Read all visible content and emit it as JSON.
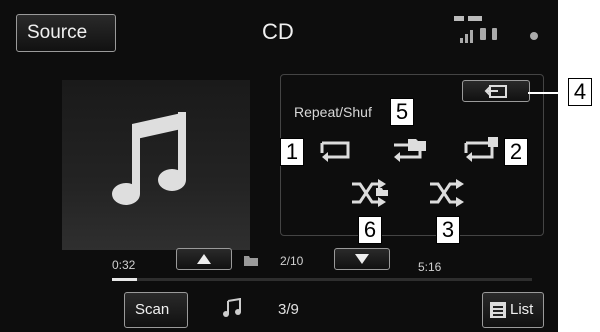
{
  "header": {
    "source_label": "Source",
    "title": "CD"
  },
  "repeat_shuffle": {
    "label": "Repeat/Shuf"
  },
  "playback": {
    "elapsed": "0:32",
    "track_position": "2/10",
    "total": "5:16",
    "progress_fraction": 0.06
  },
  "footer": {
    "scan_label": "Scan",
    "track_count": "3/9",
    "list_label": "List"
  },
  "callouts": {
    "c1": "1",
    "c2": "2",
    "c3": "3",
    "c4": "4",
    "c5": "5",
    "c6": "6"
  },
  "colors": {
    "screen_bg": "#0d0d0d",
    "text": "#e0e0e0",
    "border": "#9a9a9a"
  }
}
